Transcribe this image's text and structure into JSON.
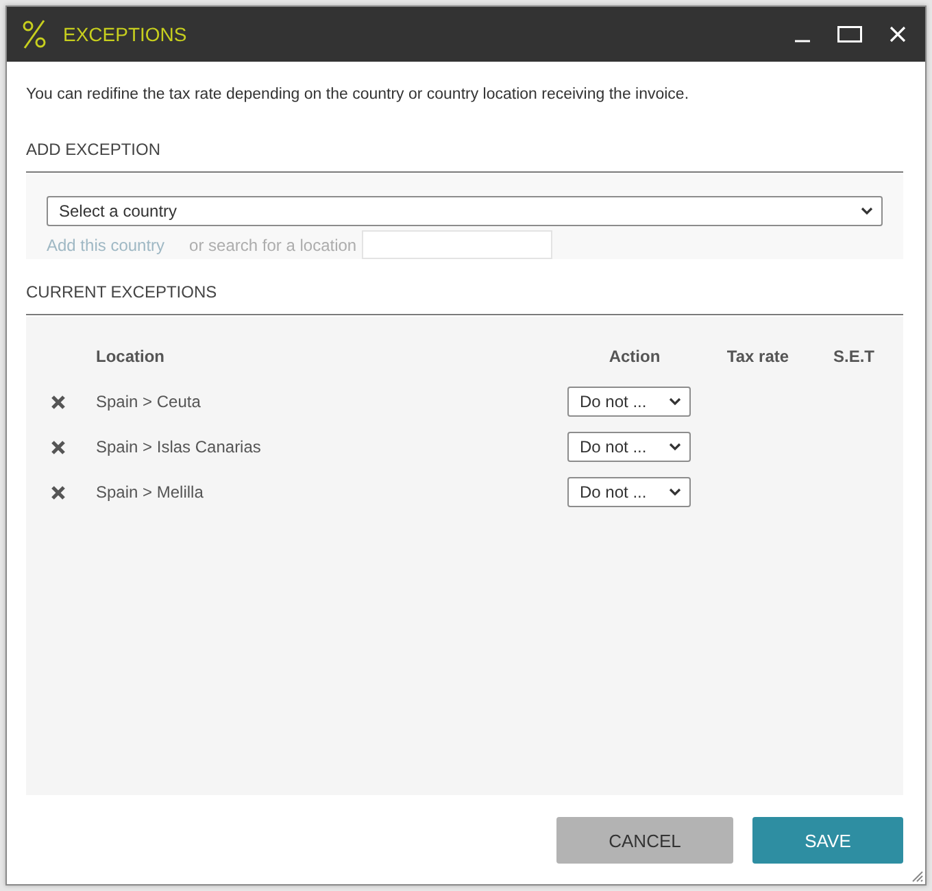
{
  "window": {
    "title": "EXCEPTIONS"
  },
  "description": "You can redifine the tax rate depending on the country or country location receiving the invoice.",
  "add_exception": {
    "heading": "ADD EXCEPTION",
    "country_select": {
      "value": "Select a country"
    },
    "add_link": {
      "label": "Add this country",
      "disabled": true
    },
    "search_label": "or search for a location"
  },
  "current_exceptions": {
    "heading": "CURRENT EXCEPTIONS",
    "columns": [
      "Location",
      "Action",
      "Tax rate",
      "S.E.T"
    ],
    "rows": [
      {
        "location": "Spain > Ceuta",
        "action": "Do not ..."
      },
      {
        "location": "Spain > Islas Canarias",
        "action": "Do not ..."
      },
      {
        "location": "Spain > Melilla",
        "action": "Do not ..."
      }
    ]
  },
  "buttons": [
    {
      "label": "CANCEL",
      "kind": "secondary"
    },
    {
      "label": "SAVE",
      "kind": "primary"
    }
  ]
}
